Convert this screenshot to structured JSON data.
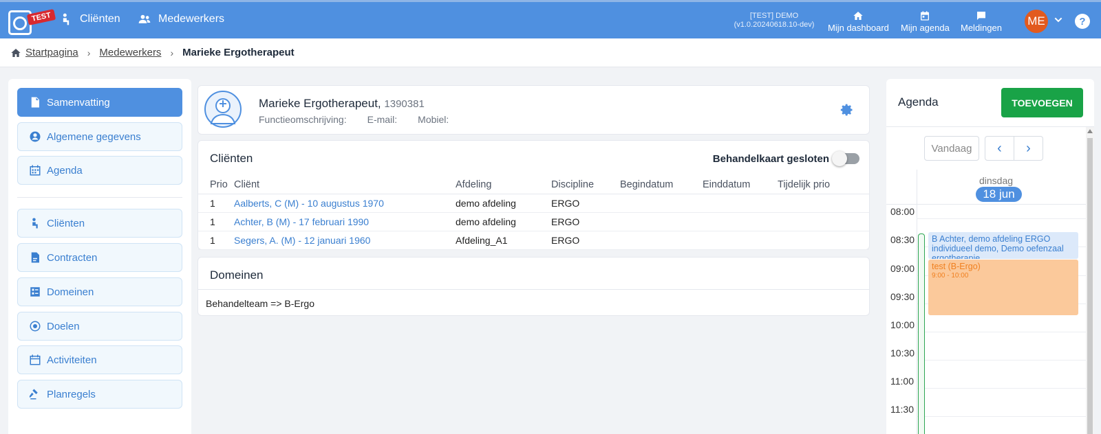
{
  "app": {
    "badge": "TEST",
    "nav": [
      {
        "label": "Cliënten",
        "icon": "client-icon"
      },
      {
        "label": "Medewerkers",
        "icon": "employees-icon"
      }
    ],
    "version_line1": "[TEST] DEMO",
    "version_line2": "(v1.0.20240618.10-dev)",
    "quicknav": [
      {
        "label": "Mijn dashboard",
        "icon": "home-icon"
      },
      {
        "label": "Mijn agenda",
        "icon": "calendar-icon"
      },
      {
        "label": "Meldingen",
        "icon": "chat-icon"
      }
    ],
    "avatar_initials": "ME",
    "help": "?",
    "colors": {
      "primary": "#4f90e0",
      "add": "#19a347",
      "badge": "#d8292f",
      "avatar": "#e25a1e"
    }
  },
  "breadcrumb": {
    "home": "Startpagina",
    "level1": "Medewerkers",
    "current": "Marieke Ergotherapeut"
  },
  "sidebar": {
    "items": [
      {
        "label": "Samenvatting",
        "icon": "document-icon",
        "active": true
      },
      {
        "label": "Algemene gegevens",
        "icon": "user-circle-icon"
      },
      {
        "label": "Agenda",
        "icon": "calendar-icon"
      },
      {
        "label": "Cliënten",
        "icon": "client-icon"
      },
      {
        "label": "Contracten",
        "icon": "contract-icon"
      },
      {
        "label": "Domeinen",
        "icon": "checklist-icon"
      },
      {
        "label": "Doelen",
        "icon": "target-icon"
      },
      {
        "label": "Activiteiten",
        "icon": "calendar-outline-icon"
      },
      {
        "label": "Planregels",
        "icon": "gavel-icon"
      }
    ]
  },
  "profile": {
    "name": "Marieke Ergotherapeut,",
    "number": "1390381",
    "function_label": "Functieomschrijving:",
    "email_label": "E-mail:",
    "mobile_label": "Mobiel:"
  },
  "clients": {
    "title": "Cliënten",
    "toggle_label": "Behandelkaart gesloten",
    "columns": [
      "Prio",
      "Cliënt",
      "Afdeling",
      "Discipline",
      "Begindatum",
      "Einddatum",
      "Tijdelijk prio"
    ],
    "rows": [
      [
        "1",
        "Aalberts, C (M) - 10 augustus 1970",
        "demo afdeling",
        "ERGO",
        "",
        "",
        ""
      ],
      [
        "1",
        "Achter, B (M) - 17 februari 1990",
        "demo afdeling",
        "ERGO",
        "",
        "",
        ""
      ],
      [
        "1",
        "Segers, A. (M) - 12 januari 1960",
        "Afdeling_A1",
        "ERGO",
        "",
        "",
        ""
      ]
    ]
  },
  "domains": {
    "title": "Domeinen",
    "row": "Behandelteam => B-Ergo"
  },
  "agenda": {
    "title": "Agenda",
    "add_label": "TOEVOEGEN",
    "today_label": "Vandaag",
    "prev": "‹",
    "next": "›",
    "day_name": "dinsdag",
    "day_date": "18 jun",
    "times": [
      "08:00",
      "08:30",
      "09:00",
      "09:30",
      "10:00",
      "10:30",
      "11:00",
      "11:30"
    ],
    "event1": "B Achter, demo afdeling ERGO individueel demo, Demo oefenzaal ergotherapie",
    "event2_title": "test (B-Ergo)",
    "event2_time": "9:00 - 10:00"
  }
}
